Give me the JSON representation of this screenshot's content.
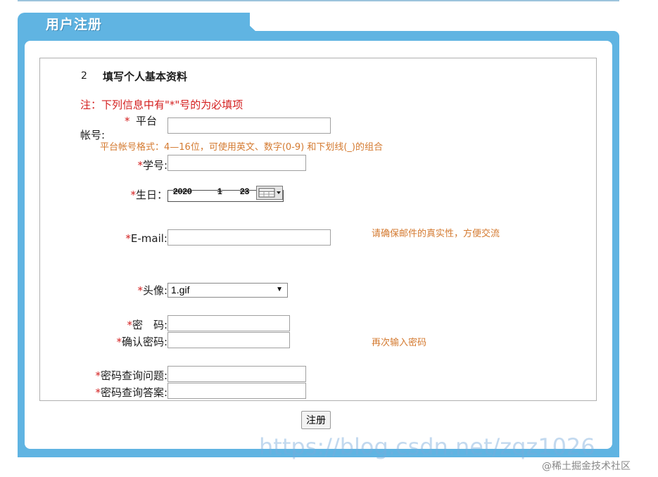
{
  "header": {
    "title": "用户注册"
  },
  "section": {
    "number": "2",
    "title": "填写个人基本资料"
  },
  "note": "注：下列信息中有\"*\"号的为必填项",
  "fields": {
    "platform_account": {
      "star": "*",
      "label_line1": "平台",
      "label_line2": "帐号:",
      "value": "",
      "hint": "平台帐号格式：4—16位，可使用英文、数字(0-9) 和下划线(_)的组合"
    },
    "student_id": {
      "star": "*",
      "label": "学号:",
      "value": ""
    },
    "birthday": {
      "star": "*",
      "label": "生日：",
      "year": "2020",
      "month": "1",
      "day": "23"
    },
    "email": {
      "star": "*",
      "label": "E-mail:",
      "value": "",
      "hint": "请确保邮件的真实性，方便交流"
    },
    "avatar": {
      "star": "*",
      "label": "头像:",
      "selected": "1.gif"
    },
    "password": {
      "star": "*",
      "label": "密　码:",
      "value": ""
    },
    "confirm_password": {
      "star": "*",
      "label": "确认密码:",
      "value": "",
      "hint": "再次输入密码"
    },
    "security_question": {
      "star": "*",
      "label": "密码查询问题:",
      "value": ""
    },
    "security_answer": {
      "star": "*",
      "label": "密码查询答案:",
      "value": ""
    }
  },
  "submit_label": "注册",
  "watermark": "https://blog.csdn.net/zqz1026",
  "credit": "@稀土掘金技术社区",
  "colors": {
    "accent": "#60b4e2",
    "required": "#d42020",
    "hint": "#d47a30"
  }
}
